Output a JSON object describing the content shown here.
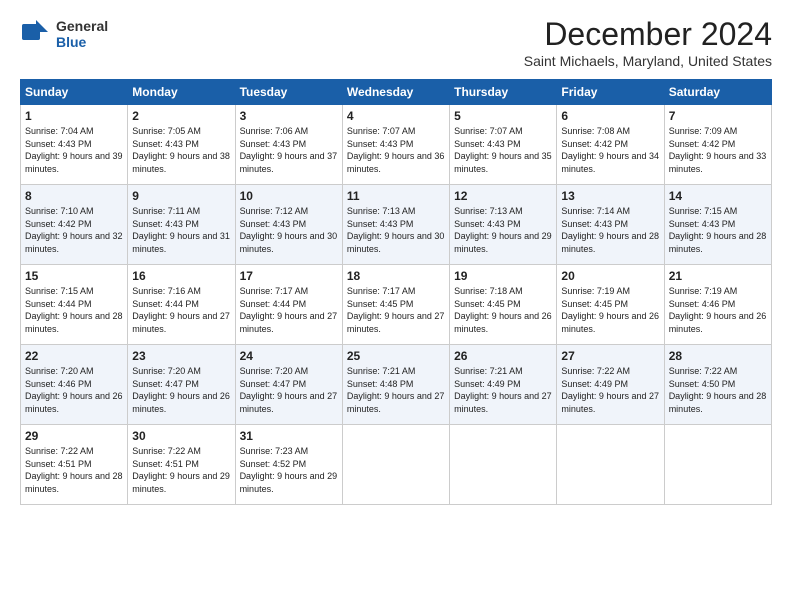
{
  "header": {
    "logo_general": "General",
    "logo_blue": "Blue",
    "main_title": "December 2024",
    "subtitle": "Saint Michaels, Maryland, United States"
  },
  "weekdays": [
    "Sunday",
    "Monday",
    "Tuesday",
    "Wednesday",
    "Thursday",
    "Friday",
    "Saturday"
  ],
  "weeks": [
    [
      {
        "day": "1",
        "sunrise": "7:04 AM",
        "sunset": "4:43 PM",
        "daylight": "9 hours and 39 minutes."
      },
      {
        "day": "2",
        "sunrise": "7:05 AM",
        "sunset": "4:43 PM",
        "daylight": "9 hours and 38 minutes."
      },
      {
        "day": "3",
        "sunrise": "7:06 AM",
        "sunset": "4:43 PM",
        "daylight": "9 hours and 37 minutes."
      },
      {
        "day": "4",
        "sunrise": "7:07 AM",
        "sunset": "4:43 PM",
        "daylight": "9 hours and 36 minutes."
      },
      {
        "day": "5",
        "sunrise": "7:07 AM",
        "sunset": "4:43 PM",
        "daylight": "9 hours and 35 minutes."
      },
      {
        "day": "6",
        "sunrise": "7:08 AM",
        "sunset": "4:42 PM",
        "daylight": "9 hours and 34 minutes."
      },
      {
        "day": "7",
        "sunrise": "7:09 AM",
        "sunset": "4:42 PM",
        "daylight": "9 hours and 33 minutes."
      }
    ],
    [
      {
        "day": "8",
        "sunrise": "7:10 AM",
        "sunset": "4:42 PM",
        "daylight": "9 hours and 32 minutes."
      },
      {
        "day": "9",
        "sunrise": "7:11 AM",
        "sunset": "4:43 PM",
        "daylight": "9 hours and 31 minutes."
      },
      {
        "day": "10",
        "sunrise": "7:12 AM",
        "sunset": "4:43 PM",
        "daylight": "9 hours and 30 minutes."
      },
      {
        "day": "11",
        "sunrise": "7:13 AM",
        "sunset": "4:43 PM",
        "daylight": "9 hours and 30 minutes."
      },
      {
        "day": "12",
        "sunrise": "7:13 AM",
        "sunset": "4:43 PM",
        "daylight": "9 hours and 29 minutes."
      },
      {
        "day": "13",
        "sunrise": "7:14 AM",
        "sunset": "4:43 PM",
        "daylight": "9 hours and 28 minutes."
      },
      {
        "day": "14",
        "sunrise": "7:15 AM",
        "sunset": "4:43 PM",
        "daylight": "9 hours and 28 minutes."
      }
    ],
    [
      {
        "day": "15",
        "sunrise": "7:15 AM",
        "sunset": "4:44 PM",
        "daylight": "9 hours and 28 minutes."
      },
      {
        "day": "16",
        "sunrise": "7:16 AM",
        "sunset": "4:44 PM",
        "daylight": "9 hours and 27 minutes."
      },
      {
        "day": "17",
        "sunrise": "7:17 AM",
        "sunset": "4:44 PM",
        "daylight": "9 hours and 27 minutes."
      },
      {
        "day": "18",
        "sunrise": "7:17 AM",
        "sunset": "4:45 PM",
        "daylight": "9 hours and 27 minutes."
      },
      {
        "day": "19",
        "sunrise": "7:18 AM",
        "sunset": "4:45 PM",
        "daylight": "9 hours and 26 minutes."
      },
      {
        "day": "20",
        "sunrise": "7:19 AM",
        "sunset": "4:45 PM",
        "daylight": "9 hours and 26 minutes."
      },
      {
        "day": "21",
        "sunrise": "7:19 AM",
        "sunset": "4:46 PM",
        "daylight": "9 hours and 26 minutes."
      }
    ],
    [
      {
        "day": "22",
        "sunrise": "7:20 AM",
        "sunset": "4:46 PM",
        "daylight": "9 hours and 26 minutes."
      },
      {
        "day": "23",
        "sunrise": "7:20 AM",
        "sunset": "4:47 PM",
        "daylight": "9 hours and 26 minutes."
      },
      {
        "day": "24",
        "sunrise": "7:20 AM",
        "sunset": "4:47 PM",
        "daylight": "9 hours and 27 minutes."
      },
      {
        "day": "25",
        "sunrise": "7:21 AM",
        "sunset": "4:48 PM",
        "daylight": "9 hours and 27 minutes."
      },
      {
        "day": "26",
        "sunrise": "7:21 AM",
        "sunset": "4:49 PM",
        "daylight": "9 hours and 27 minutes."
      },
      {
        "day": "27",
        "sunrise": "7:22 AM",
        "sunset": "4:49 PM",
        "daylight": "9 hours and 27 minutes."
      },
      {
        "day": "28",
        "sunrise": "7:22 AM",
        "sunset": "4:50 PM",
        "daylight": "9 hours and 28 minutes."
      }
    ],
    [
      {
        "day": "29",
        "sunrise": "7:22 AM",
        "sunset": "4:51 PM",
        "daylight": "9 hours and 28 minutes."
      },
      {
        "day": "30",
        "sunrise": "7:22 AM",
        "sunset": "4:51 PM",
        "daylight": "9 hours and 29 minutes."
      },
      {
        "day": "31",
        "sunrise": "7:23 AM",
        "sunset": "4:52 PM",
        "daylight": "9 hours and 29 minutes."
      },
      null,
      null,
      null,
      null
    ]
  ]
}
